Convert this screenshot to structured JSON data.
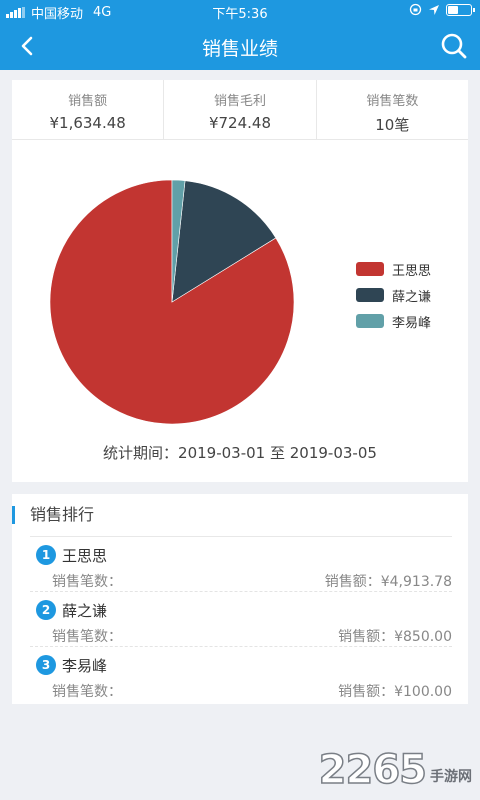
{
  "status_bar": {
    "carrier": "中国移动",
    "network": "4G",
    "time": "下午5:36"
  },
  "nav": {
    "title": "销售业绩",
    "back_icon": "back-arrow-icon",
    "search_icon": "search-icon"
  },
  "summary": {
    "stats": [
      {
        "label": "销售额",
        "value": "¥1,634.48"
      },
      {
        "label": "销售毛利",
        "value": "¥724.48"
      },
      {
        "label": "销售笔数",
        "value": "10笔"
      }
    ],
    "period": "统计期间：2019-03-01 至 2019-03-05"
  },
  "chart_data": {
    "type": "pie",
    "slices": [
      {
        "name": "王思思",
        "value": 4913.78,
        "color": "#c23531"
      },
      {
        "name": "薛之谦",
        "value": 850.0,
        "color": "#2f4554"
      },
      {
        "name": "李易峰",
        "value": 100.0,
        "color": "#61a0a8"
      }
    ],
    "legend_position": "right"
  },
  "ranking": {
    "title": "销售排行",
    "items": [
      {
        "rank": "1",
        "name": "王思思",
        "count_label": "销售笔数：",
        "amount": "销售额：¥4,913.78"
      },
      {
        "rank": "2",
        "name": "薛之谦",
        "count_label": "销售笔数：",
        "amount": "销售额：¥850.00"
      },
      {
        "rank": "3",
        "name": "李易峰",
        "count_label": "销售笔数：",
        "amount": "销售额：¥100.00"
      }
    ]
  },
  "watermark": {
    "number": "2265",
    "text": "手游网"
  }
}
